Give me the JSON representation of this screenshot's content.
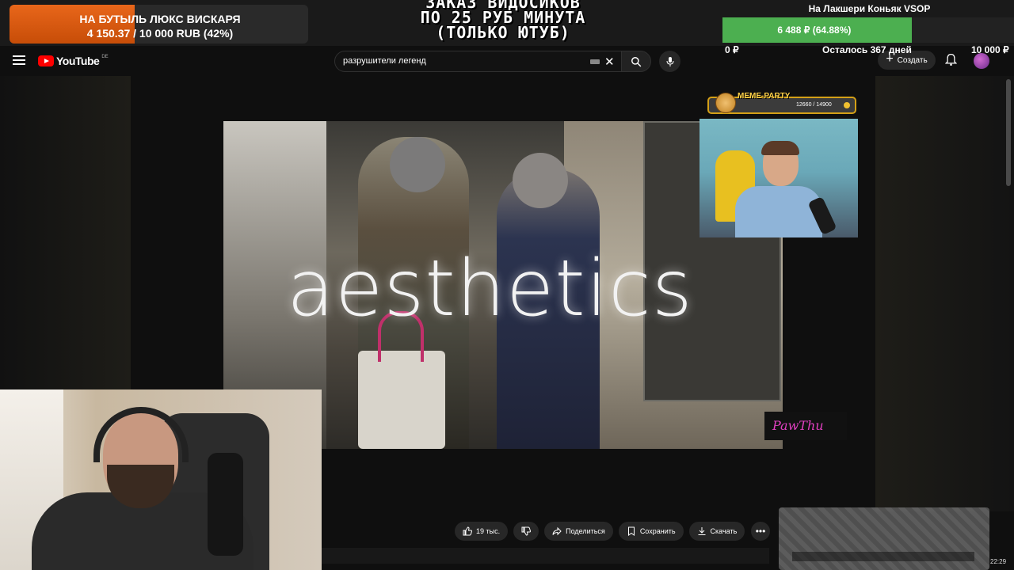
{
  "stream_overlay": {
    "goal_left": {
      "title": "НА БУТЫЛЬ ЛЮКС ВИСКАРЯ",
      "amount": "4 150.37 / 10 000 RUB (42%)",
      "progress": 0.42
    },
    "promo_lines": [
      "ЗАКАЗ ВИДОСИКОВ",
      "ПО 25 РУБ МИНУТА",
      "(ТОЛЬКО ЮТУБ)"
    ],
    "goal_right": {
      "title": "На Лакшери Коньяк VSOP",
      "label": "6 488 ₽ (64.88%)",
      "progress": 0.6488,
      "min": "0 ₽",
      "remaining": "Осталось 367 дней",
      "max": "10 000 ₽"
    },
    "meme_party": {
      "title": "MEME-PARTY",
      "count": "12660 / 14900"
    }
  },
  "header": {
    "logo_text": "YouTube",
    "country_code": "DE",
    "search_value": "разрушители легенд",
    "create_label": "Создать"
  },
  "video": {
    "overlay_text": "aesthetics",
    "watermark": "PawThu"
  },
  "actions": {
    "likes": "19 тыс.",
    "share": "Поделиться",
    "save": "Сохранить",
    "download": "Скачать"
  },
  "taskbar": {
    "clock": "22:29"
  },
  "colors": {
    "accent_orange": "#e8661a",
    "accent_green": "#4caf50",
    "youtube_red": "#ff0000"
  }
}
